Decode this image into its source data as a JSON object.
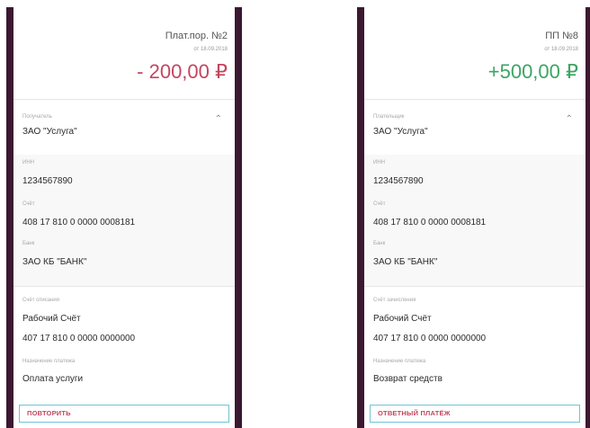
{
  "left": {
    "doc_title": "Плат.пор. №2",
    "doc_date": "от 18.09.2018",
    "amount": "- 200,00 ₽",
    "party_label": "Получатель",
    "party_value": "ЗАО \"Услуга\"",
    "inn_label": "ИНН",
    "inn_value": "1234567890",
    "account_label": "Счёт",
    "account_value": "408 17 810 0 0000 0008181",
    "bank_label": "Банк",
    "bank_value": "ЗАО КБ \"БАНК\"",
    "debit_label": "Счёт списания",
    "debit_name": "Рабочий Счёт",
    "debit_number": "407 17 810 0 0000 0000000",
    "purpose_label": "Назначение платежа",
    "purpose_value": "Оплата услуги",
    "action_label": "ПОВТОРИТЬ"
  },
  "right": {
    "doc_title": "ПП №8",
    "doc_date": "от 18.09.2018",
    "amount": "+500,00 ₽",
    "party_label": "Плательщик",
    "party_value": "ЗАО \"Услуга\"",
    "inn_label": "ИНН",
    "inn_value": "1234567890",
    "account_label": "Счёт",
    "account_value": "408 17 810 0 0000 0008181",
    "bank_label": "Банк",
    "bank_value": "ЗАО КБ \"БАНК\"",
    "debit_label": "Счёт зачисления",
    "debit_name": "Рабочий Счёт",
    "debit_number": "407 17 810 0 0000 0000000",
    "purpose_label": "Назначение платежа",
    "purpose_value": "Возврат средств",
    "action_label": "ОТВЕТНЫЙ ПЛАТЁЖ"
  },
  "icons": {
    "collapse": "chevron-up-icon"
  },
  "colors": {
    "negative": "#c2465e",
    "positive": "#3ba564",
    "button_border": "#6fc4d6",
    "frame": "#5a2a48"
  }
}
